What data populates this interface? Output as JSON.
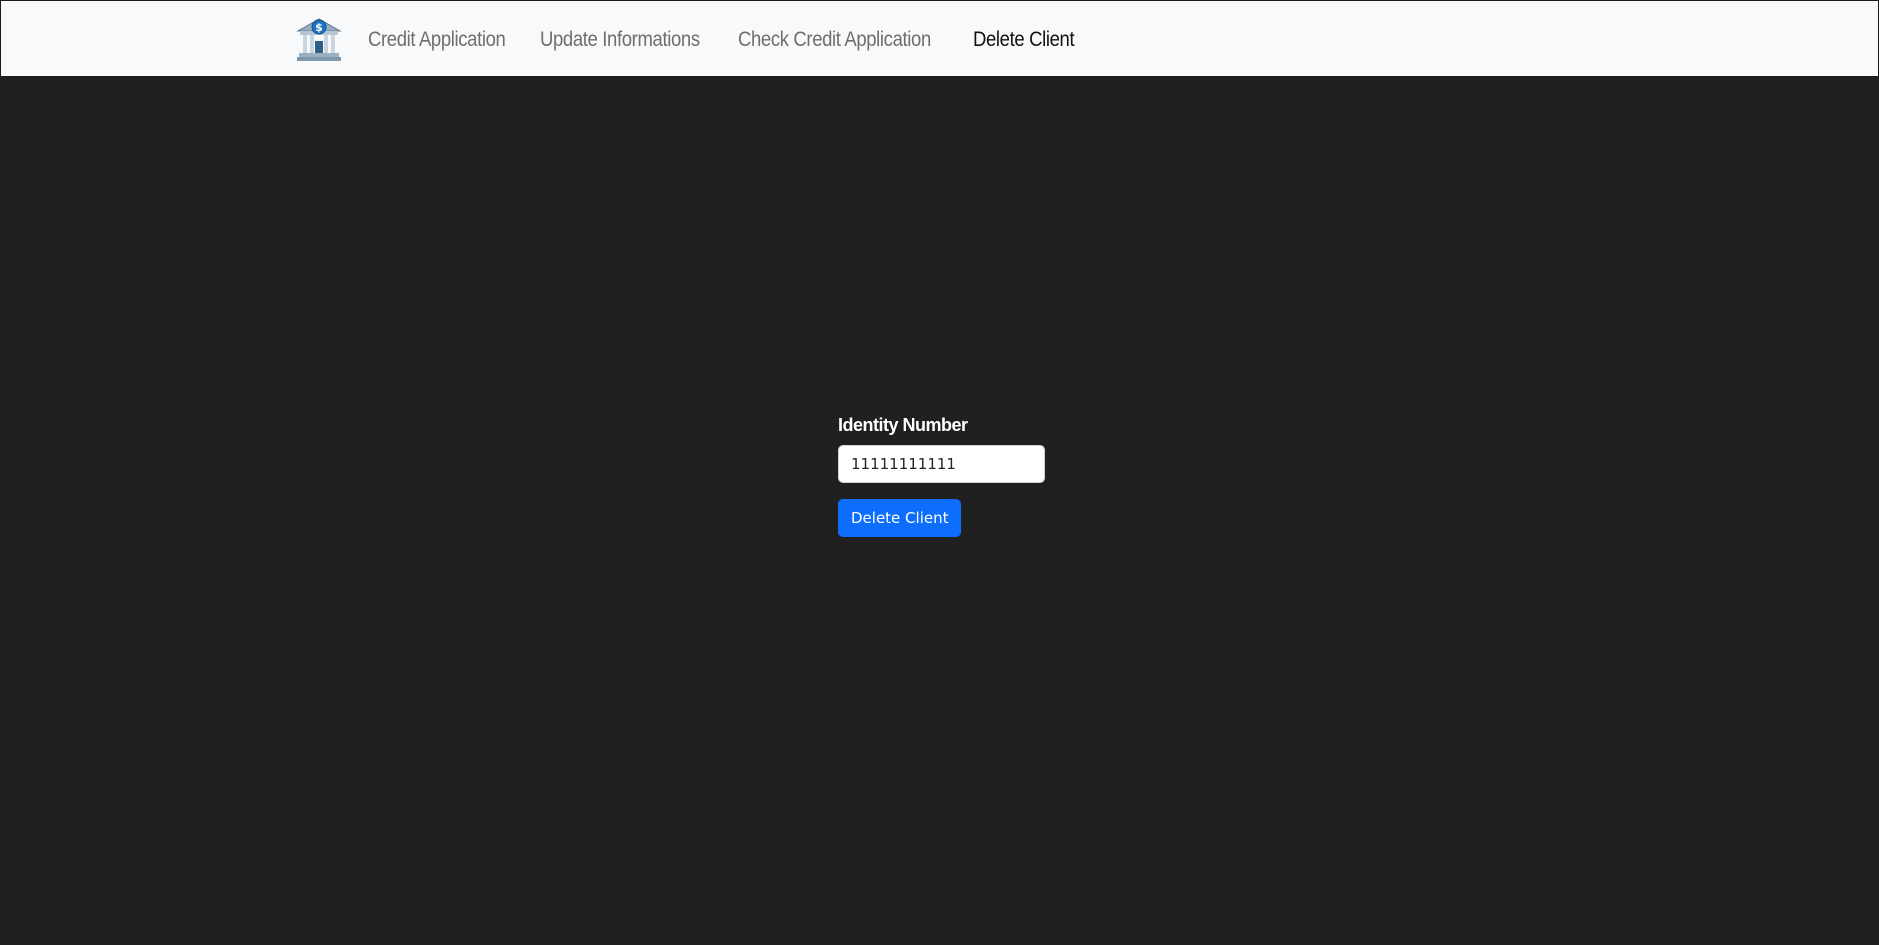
{
  "navbar": {
    "logo_icon": "bank-building-dollar-icon",
    "links": [
      {
        "label": "Credit Application",
        "active": false
      },
      {
        "label": "Update Informations",
        "active": false
      },
      {
        "label": "Check Credit Application",
        "active": false
      },
      {
        "label": "Delete Client",
        "active": true
      }
    ]
  },
  "form": {
    "label": "Identity Number",
    "identity_value": "11111111111",
    "submit_label": "Delete Client"
  },
  "colors": {
    "background": "#202020",
    "navbar": "#f8f9fa",
    "accent": "#0d6efd",
    "nav_link": "#6e6e6e",
    "nav_link_active": "#111111"
  }
}
